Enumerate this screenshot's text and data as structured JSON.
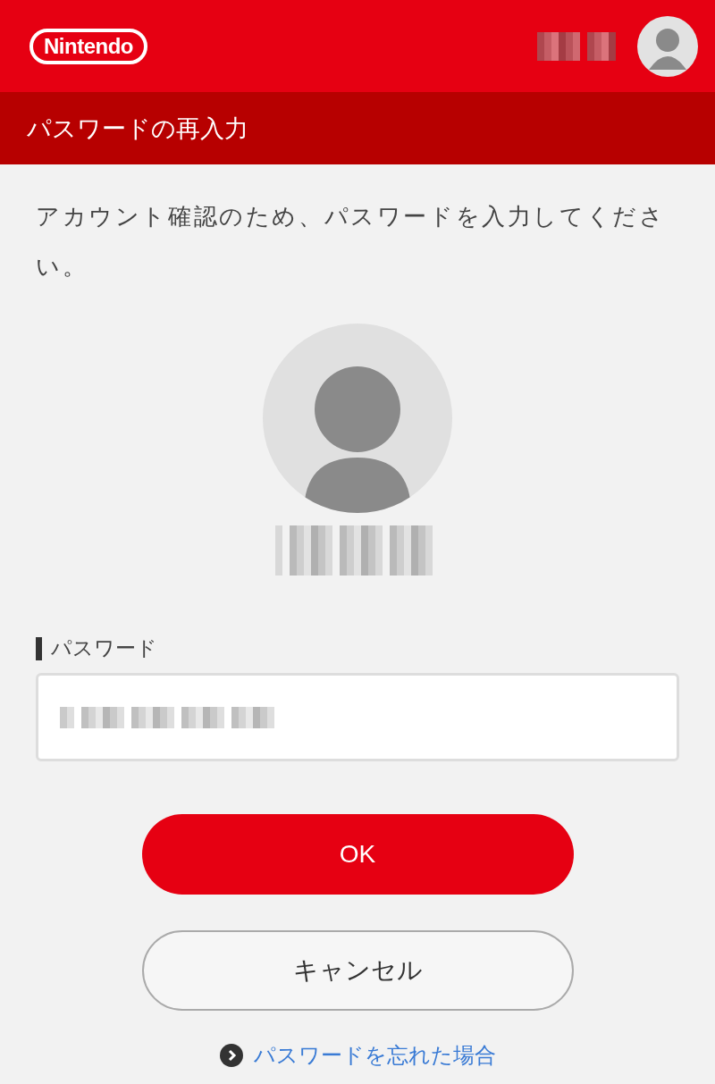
{
  "header": {
    "logo": "Nintendo"
  },
  "title": "パスワードの再入力",
  "message": "アカウント確認のため、パスワードを入力してください。",
  "password": {
    "label": "パスワード"
  },
  "buttons": [
    {
      "kind": "primary",
      "label": "OK"
    },
    {
      "kind": "secondary",
      "label": "キャンセル"
    }
  ],
  "link": {
    "label": "パスワードを忘れた場合"
  }
}
